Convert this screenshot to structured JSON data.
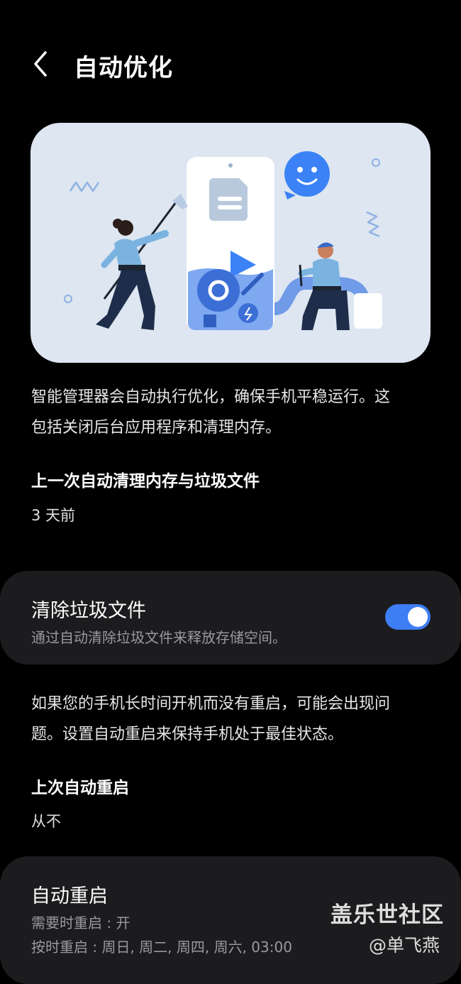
{
  "header": {
    "title": "自动优化",
    "back_icon": "chevron-left-icon"
  },
  "hero": {
    "illustration": "phone-cleaning-illustration"
  },
  "optimize": {
    "description_line1": "智能管理器会自动执行优化，确保手机平稳运行。这",
    "description_line2": "包括关闭后台应用程序和清理内存。",
    "last_clean_label": "上一次自动清理内存与垃圾文件",
    "last_clean_value": "3 天前"
  },
  "junk_card": {
    "title": "清除垃圾文件",
    "subtitle": "通过自动清除垃圾文件来释放存储空间。",
    "toggle_on": true,
    "accent_color": "#3e7ef5"
  },
  "restart": {
    "description_line1": "如果您的手机长时间开机而没有重启，可能会出现问",
    "description_line2": "题。设置自动重启来保持手机处于最佳状态。",
    "last_restart_label": "上次自动重启",
    "last_restart_value": "从不"
  },
  "restart_card": {
    "title": "自动重启",
    "line1": "需要时重启 : 开",
    "line2": "按时重启 : 周日, 周二, 周四, 周六, 03:00"
  },
  "watermark": {
    "line1": "盖乐世社区",
    "line2": "@单飞燕"
  }
}
